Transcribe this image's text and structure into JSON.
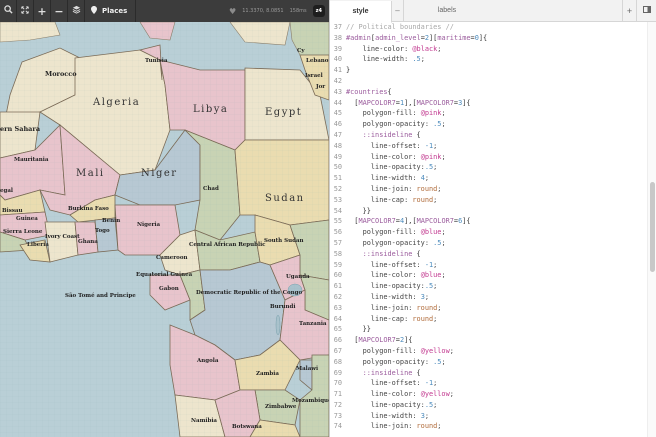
{
  "map": {
    "toolbar": {
      "places_label": "Places",
      "coords": "11.3370, 8.0851",
      "render_time": "158ms",
      "zoom": "z4"
    },
    "countries": [
      {
        "id": "morocco",
        "label": "Morocco",
        "size": "mid"
      },
      {
        "id": "algeria",
        "label": "Algeria",
        "size": "big"
      },
      {
        "id": "tunisia",
        "label": "Tunisia",
        "size": "sm"
      },
      {
        "id": "libya",
        "label": "Libya",
        "size": "big"
      },
      {
        "id": "egypt",
        "label": "Egypt",
        "size": "big"
      },
      {
        "id": "western-sahara",
        "label": "ern Sahara",
        "size": "mid"
      },
      {
        "id": "mauritania",
        "label": "Mauritania",
        "size": "sm"
      },
      {
        "id": "mali",
        "label": "Mali",
        "size": "big"
      },
      {
        "id": "niger",
        "label": "Niger",
        "size": "big"
      },
      {
        "id": "chad",
        "label": "Chad",
        "size": "sm"
      },
      {
        "id": "sudan",
        "label": "Sudan",
        "size": "big"
      },
      {
        "id": "senegal",
        "label": "egal",
        "size": "sm"
      },
      {
        "id": "burkina-faso",
        "label": "Burkina Faso",
        "size": "sm"
      },
      {
        "id": "benin",
        "label": "Benin",
        "size": "sm"
      },
      {
        "id": "nigeria",
        "label": "Nigeria",
        "size": "sm"
      },
      {
        "id": "bissau",
        "label": "Bissau",
        "size": "sm"
      },
      {
        "id": "guinea",
        "label": "Guinea",
        "size": "sm"
      },
      {
        "id": "sierra-leone",
        "label": "Sierra Leone",
        "size": "sm"
      },
      {
        "id": "liberia",
        "label": "Liberia",
        "size": "sm"
      },
      {
        "id": "ivory-coast",
        "label": "Ivory Coast",
        "size": "sm"
      },
      {
        "id": "ghana",
        "label": "Ghana",
        "size": "sm"
      },
      {
        "id": "togo",
        "label": "Togo",
        "size": "sm"
      },
      {
        "id": "car",
        "label": "Central African Republic",
        "size": "sm"
      },
      {
        "id": "south-sudan",
        "label": "South Sudan",
        "size": "sm"
      },
      {
        "id": "cameroon",
        "label": "Cameroon",
        "size": "sm"
      },
      {
        "id": "eq-guinea",
        "label": "Equatorial Guinea",
        "size": "sm"
      },
      {
        "id": "gabon",
        "label": "Gabon",
        "size": "sm"
      },
      {
        "id": "sao-tome",
        "label": "São Tomé and Principe",
        "size": "sm"
      },
      {
        "id": "drc",
        "label": "Democratic Republic of the Congo",
        "size": "sm"
      },
      {
        "id": "uganda",
        "label": "Uganda",
        "size": "sm"
      },
      {
        "id": "burundi",
        "label": "Burundi",
        "size": "sm"
      },
      {
        "id": "tanzania",
        "label": "Tanzania",
        "size": "sm"
      },
      {
        "id": "angola",
        "label": "Angola",
        "size": "sm"
      },
      {
        "id": "zambia",
        "label": "Zambia",
        "size": "sm"
      },
      {
        "id": "malawi",
        "label": "Malawi",
        "size": "sm"
      },
      {
        "id": "mozambique",
        "label": "Mozambique",
        "size": "sm"
      },
      {
        "id": "zimbabwe",
        "label": "Zimbabwe",
        "size": "sm"
      },
      {
        "id": "namibia",
        "label": "Namibia",
        "size": "sm"
      },
      {
        "id": "botswana",
        "label": "Botswana",
        "size": "sm"
      },
      {
        "id": "israel",
        "label": "Israel",
        "size": "sm"
      },
      {
        "id": "lebanon",
        "label": "Lebanon",
        "size": "sm"
      },
      {
        "id": "cyprus",
        "label": "Cy",
        "size": "sm"
      },
      {
        "id": "jordan",
        "label": "Jor",
        "size": "sm"
      }
    ]
  },
  "editor": {
    "tabs": {
      "style": "style",
      "close": "–",
      "labels": "labels",
      "add": "+"
    },
    "lines": [
      {
        "n": "37",
        "tokens": [
          [
            "com",
            "// Political boundaries //"
          ]
        ]
      },
      {
        "n": "38",
        "tokens": [
          [
            "sel",
            "#admin"
          ],
          [
            "br",
            "["
          ],
          [
            "sel",
            "admin_level"
          ],
          [
            "br",
            "="
          ],
          [
            "num",
            "2"
          ],
          [
            "br",
            "]["
          ],
          [
            "sel",
            "maritime"
          ],
          [
            "br",
            "="
          ],
          [
            "num",
            "0"
          ],
          [
            "br",
            "]{"
          ]
        ]
      },
      {
        "n": "39",
        "tokens": [
          [
            "",
            "    line-color: "
          ],
          [
            "var",
            "@black"
          ],
          [
            "",
            ";"
          ]
        ]
      },
      {
        "n": "40",
        "tokens": [
          [
            "",
            "    line-width: "
          ],
          [
            "num",
            ".5"
          ],
          [
            "",
            ";"
          ]
        ]
      },
      {
        "n": "41",
        "tokens": [
          [
            "br",
            "}"
          ]
        ]
      },
      {
        "n": "42",
        "tokens": []
      },
      {
        "n": "43",
        "tokens": [
          [
            "sel",
            "#countries"
          ],
          [
            "br",
            "{"
          ]
        ]
      },
      {
        "n": "44",
        "tokens": [
          [
            "br",
            "  ["
          ],
          [
            "sel",
            "MAPCOLOR7"
          ],
          [
            "br",
            "="
          ],
          [
            "num",
            "1"
          ],
          [
            "br",
            "],["
          ],
          [
            "sel",
            "MAPCOLOR7"
          ],
          [
            "br",
            "="
          ],
          [
            "num",
            "3"
          ],
          [
            "br",
            "]{"
          ]
        ]
      },
      {
        "n": "45",
        "tokens": [
          [
            "",
            "    polygon-fill: "
          ],
          [
            "var",
            "@pink"
          ],
          [
            "",
            ";"
          ]
        ]
      },
      {
        "n": "46",
        "tokens": [
          [
            "",
            "    polygon-opacity: "
          ],
          [
            "num",
            ".5"
          ],
          [
            "",
            ";"
          ]
        ]
      },
      {
        "n": "47",
        "tokens": [
          [
            "sel",
            "    ::insideline"
          ],
          [
            "br",
            " {"
          ]
        ]
      },
      {
        "n": "48",
        "tokens": [
          [
            "",
            "      line-offset: "
          ],
          [
            "num",
            "-1"
          ],
          [
            "",
            ";"
          ]
        ]
      },
      {
        "n": "49",
        "tokens": [
          [
            "",
            "      line-color: "
          ],
          [
            "var",
            "@pink"
          ],
          [
            "",
            ";"
          ]
        ]
      },
      {
        "n": "50",
        "tokens": [
          [
            "",
            "      line-opacity:"
          ],
          [
            "num",
            ".5"
          ],
          [
            "",
            ";"
          ]
        ]
      },
      {
        "n": "51",
        "tokens": [
          [
            "",
            "      line-width: "
          ],
          [
            "num",
            "4"
          ],
          [
            "",
            ";"
          ]
        ]
      },
      {
        "n": "52",
        "tokens": [
          [
            "",
            "      line-join: "
          ],
          [
            "kw",
            "round"
          ],
          [
            "",
            ";"
          ]
        ]
      },
      {
        "n": "53",
        "tokens": [
          [
            "",
            "      line-cap: "
          ],
          [
            "kw",
            "round"
          ],
          [
            "",
            ";"
          ]
        ]
      },
      {
        "n": "54",
        "tokens": [
          [
            "br",
            "    }}"
          ]
        ]
      },
      {
        "n": "55",
        "tokens": [
          [
            "br",
            "  ["
          ],
          [
            "sel",
            "MAPCOLOR7"
          ],
          [
            "br",
            "="
          ],
          [
            "num",
            "4"
          ],
          [
            "br",
            "],["
          ],
          [
            "sel",
            "MAPCOLOR7"
          ],
          [
            "br",
            "="
          ],
          [
            "num",
            "6"
          ],
          [
            "br",
            "]{"
          ]
        ]
      },
      {
        "n": "56",
        "tokens": [
          [
            "",
            "    polygon-fill: "
          ],
          [
            "var",
            "@blue"
          ],
          [
            "",
            ";"
          ]
        ]
      },
      {
        "n": "57",
        "tokens": [
          [
            "",
            "    polygon-opacity: "
          ],
          [
            "num",
            ".5"
          ],
          [
            "",
            ";"
          ]
        ]
      },
      {
        "n": "58",
        "tokens": [
          [
            "sel",
            "    ::insideline"
          ],
          [
            "br",
            " {"
          ]
        ]
      },
      {
        "n": "59",
        "tokens": [
          [
            "",
            "      line-offset: "
          ],
          [
            "num",
            "-1"
          ],
          [
            "",
            ";"
          ]
        ]
      },
      {
        "n": "60",
        "tokens": [
          [
            "",
            "      line-color: "
          ],
          [
            "var",
            "@blue"
          ],
          [
            "",
            ";"
          ]
        ]
      },
      {
        "n": "61",
        "tokens": [
          [
            "",
            "      line-opacity:"
          ],
          [
            "num",
            ".5"
          ],
          [
            "",
            ";"
          ]
        ]
      },
      {
        "n": "62",
        "tokens": [
          [
            "",
            "      line-width: "
          ],
          [
            "num",
            "3"
          ],
          [
            "",
            ";"
          ]
        ]
      },
      {
        "n": "63",
        "tokens": [
          [
            "",
            "      line-join: "
          ],
          [
            "kw",
            "round"
          ],
          [
            "",
            ";"
          ]
        ]
      },
      {
        "n": "64",
        "tokens": [
          [
            "",
            "      line-cap: "
          ],
          [
            "kw",
            "round"
          ],
          [
            "",
            ";"
          ]
        ]
      },
      {
        "n": "65",
        "tokens": [
          [
            "br",
            "    }}"
          ]
        ]
      },
      {
        "n": "66",
        "tokens": [
          [
            "br",
            "  ["
          ],
          [
            "sel",
            "MAPCOLOR7"
          ],
          [
            "br",
            "="
          ],
          [
            "num",
            "2"
          ],
          [
            "br",
            "]{"
          ]
        ]
      },
      {
        "n": "67",
        "tokens": [
          [
            "",
            "    polygon-fill: "
          ],
          [
            "var",
            "@yellow"
          ],
          [
            "",
            ";"
          ]
        ]
      },
      {
        "n": "68",
        "tokens": [
          [
            "",
            "    polygon-opacity: "
          ],
          [
            "num",
            ".5"
          ],
          [
            "",
            ";"
          ]
        ]
      },
      {
        "n": "69",
        "tokens": [
          [
            "sel",
            "    ::insideline"
          ],
          [
            "br",
            " {"
          ]
        ]
      },
      {
        "n": "70",
        "tokens": [
          [
            "",
            "      line-offset: "
          ],
          [
            "num",
            "-1"
          ],
          [
            "",
            ";"
          ]
        ]
      },
      {
        "n": "71",
        "tokens": [
          [
            "",
            "      line-color: "
          ],
          [
            "var",
            "@yellow"
          ],
          [
            "",
            ";"
          ]
        ]
      },
      {
        "n": "72",
        "tokens": [
          [
            "",
            "      line-opacity:"
          ],
          [
            "num",
            ".5"
          ],
          [
            "",
            ";"
          ]
        ]
      },
      {
        "n": "73",
        "tokens": [
          [
            "",
            "      line-width: "
          ],
          [
            "num",
            "3"
          ],
          [
            "",
            ";"
          ]
        ]
      },
      {
        "n": "74",
        "tokens": [
          [
            "",
            "      line-join: "
          ],
          [
            "kw",
            "round"
          ],
          [
            "",
            ";"
          ]
        ]
      }
    ]
  },
  "colors": {
    "pink": "#e8c4cc",
    "blue": "#b7c8d3",
    "yellow": "#eadcb0",
    "cream": "#ede5cd",
    "green": "#c8d3b4",
    "water": "#b9cfd6",
    "toolbar": "#3c3c3c"
  }
}
